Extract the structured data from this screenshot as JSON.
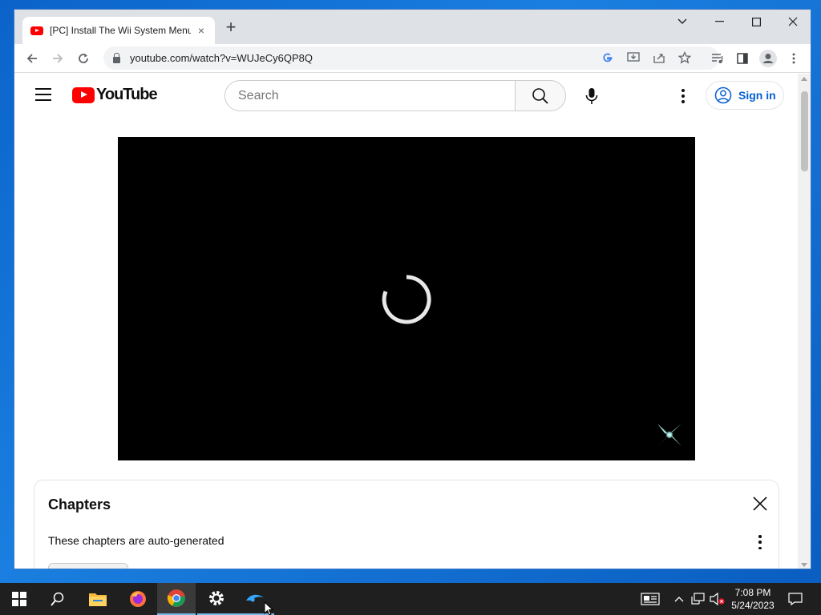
{
  "browser": {
    "tab_title": "[PC] Install The Wii System Menu",
    "tab_close": "×",
    "new_tab": "+",
    "url": "youtube.com/watch?v=WUJeCy6QP8Q",
    "window_controls": {
      "chevron": "⌄",
      "minimize": "—",
      "maximize": "☐",
      "close": "✕"
    }
  },
  "youtube": {
    "logo_text": "YouTube",
    "search_placeholder": "Search",
    "sign_in": "Sign in",
    "brand_color": "#ff0000",
    "link_color": "#065fd4"
  },
  "chapters": {
    "title": "Chapters",
    "subtitle": "These chapters are auto-generated"
  },
  "taskbar": {
    "apps": [
      "start-icon",
      "search-icon",
      "file-explorer-icon",
      "firefox-icon",
      "chrome-icon",
      "settings-icon",
      "dolphin-icon"
    ],
    "time": "7:08 PM",
    "date": "5/24/2023"
  }
}
